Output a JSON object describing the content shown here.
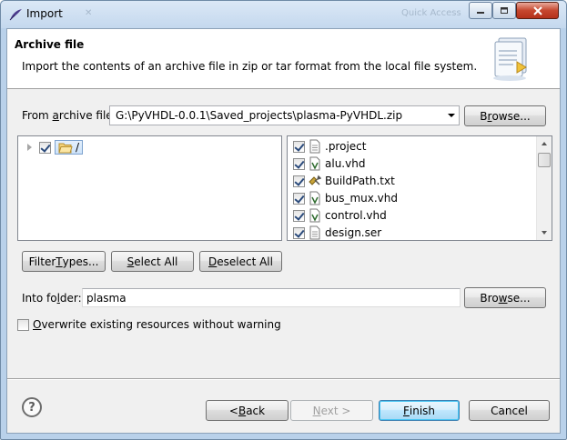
{
  "window": {
    "title": "Import",
    "minimize_glyph": "–",
    "maximize_glyph": "□",
    "close_glyph": "✕",
    "ghost_text_left": "✕",
    "ghost_text_right": "Quick Access"
  },
  "banner": {
    "title": "Archive file",
    "description": "Import the contents of an archive file in zip or tar format from the local file system.",
    "icon": "import-wizard-icon"
  },
  "archive": {
    "label_pre": "From ",
    "label_accel": "a",
    "label_post": "rchive file:",
    "value": "G:\\PyVHDL-0.0.1\\Saved_projects\\plasma-PyVHDL.zip",
    "browse_pre": "B",
    "browse_accel": "r",
    "browse_post": "owse..."
  },
  "tree": {
    "root_label": "/",
    "root_checked": true
  },
  "files": [
    {
      "name": ".project",
      "checked": true,
      "icon": "file-icon"
    },
    {
      "name": "alu.vhd",
      "checked": true,
      "icon": "vhdl-file-icon"
    },
    {
      "name": "BuildPath.txt",
      "checked": true,
      "icon": "text-file-icon"
    },
    {
      "name": "bus_mux.vhd",
      "checked": true,
      "icon": "vhdl-file-icon"
    },
    {
      "name": "control.vhd",
      "checked": true,
      "icon": "vhdl-file-icon"
    },
    {
      "name": "design.ser",
      "checked": true,
      "icon": "file-icon"
    }
  ],
  "buttons": {
    "filter_pre": "Filter ",
    "filter_accel": "T",
    "filter_post": "ypes...",
    "select_accel": "S",
    "select_post": "elect All",
    "deselect_accel": "D",
    "deselect_post": "eselect All",
    "back_pre": "< ",
    "back_accel": "B",
    "back_post": "ack",
    "next_accel": "N",
    "next_post": "ext >",
    "finish_accel": "F",
    "finish_post": "inish",
    "cancel": "Cancel"
  },
  "into_folder": {
    "label_pre": "Into fo",
    "label_accel": "l",
    "label_post": "der:",
    "value": "plasma",
    "browse_pre": "Bro",
    "browse_accel": "w",
    "browse_post": "se..."
  },
  "overwrite": {
    "accel": "O",
    "label_post": "verwrite existing resources without warning",
    "checked": false
  },
  "help": {
    "glyph": "?",
    "icon": "help-icon"
  }
}
